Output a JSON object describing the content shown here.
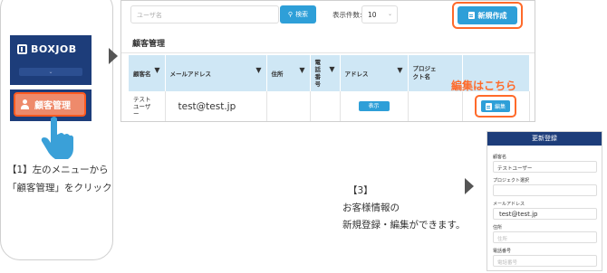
{
  "step1": {
    "logo_text": "BOXJOB",
    "menu_label": "顧客管理",
    "line1": "【1】左のメニューから",
    "line2": "「顧客管理」をクリック"
  },
  "toolbar": {
    "search_placeholder": "ユーザ名",
    "search_label": "検索",
    "count_label": "表示件数:",
    "count_value": "10",
    "new_label": "新規作成"
  },
  "page_title": "顧客管理",
  "table": {
    "headers": [
      "顧客名",
      "メールアドレス",
      "住所",
      "電話番号",
      "アドレス",
      "プロジェクト名",
      ""
    ],
    "row": {
      "name_lines": [
        "テスト",
        "ユーザ",
        "ー"
      ],
      "email": "test@test.jp",
      "show_label": "表示",
      "edit_label": "編集"
    }
  },
  "callout": "編集はこちら",
  "step3": {
    "line1": "【3】",
    "line2": "お客様情報の",
    "line3": "新規登録・編集ができます。"
  },
  "form": {
    "title": "更新登録",
    "fields": [
      {
        "label": "顧客名",
        "value": "テストユーザー"
      },
      {
        "label": "プロジェクト選択",
        "value": ""
      },
      {
        "label": "メールアドレス",
        "value": "test@test.jp"
      },
      {
        "label": "住所",
        "value": "住所"
      },
      {
        "label": "電話番号",
        "value": "電話番号"
      }
    ]
  },
  "colors": {
    "navy": "#1d3d7a",
    "accent_blue": "#2e9fd8",
    "highlight_orange": "#ff6a2a",
    "menu_fill": "#ee8a6b"
  }
}
